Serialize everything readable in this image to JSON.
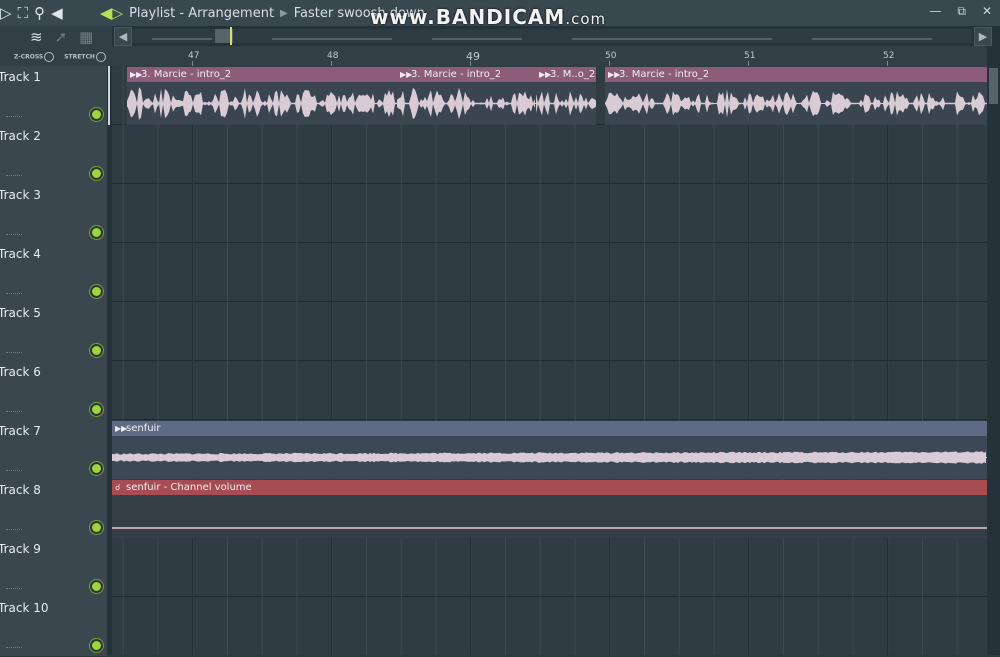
{
  "titlebar": {
    "window": "Playlist - Arrangement",
    "pattern": "Faster swoosh down",
    "icons": [
      "snap-icon",
      "zoom-icon",
      "search-icon",
      "speaker-icon"
    ]
  },
  "watermark": {
    "main": "www.BANDICAM",
    "suffix": ".com"
  },
  "toolbar": {
    "zcross_label": "Z-CROSS",
    "stretch_label": "STRETCH"
  },
  "ruler": {
    "bars": [
      "47",
      "48",
      "49",
      "50",
      "51",
      "52"
    ]
  },
  "tracks": [
    {
      "name": "Track 1"
    },
    {
      "name": "Track 2"
    },
    {
      "name": "Track 3"
    },
    {
      "name": "Track 4"
    },
    {
      "name": "Track 5"
    },
    {
      "name": "Track 6"
    },
    {
      "name": "Track 7"
    },
    {
      "name": "Track 8"
    },
    {
      "name": "Track 9"
    },
    {
      "name": "Track 10"
    }
  ],
  "clips": {
    "c1": "3. Marcie - intro_2",
    "c2": "3. Marcie - intro_2",
    "c3": "3. M..o_2",
    "c4": "3. Marcie - intro_2",
    "c5": "senfuir",
    "c6": "senfuir - Channel volume"
  },
  "colors": {
    "audio_clip": "#8c5c7a",
    "senfuir_clip": "#5f6b85",
    "automation_clip": "#a64c52",
    "led": "#9ed43c"
  }
}
